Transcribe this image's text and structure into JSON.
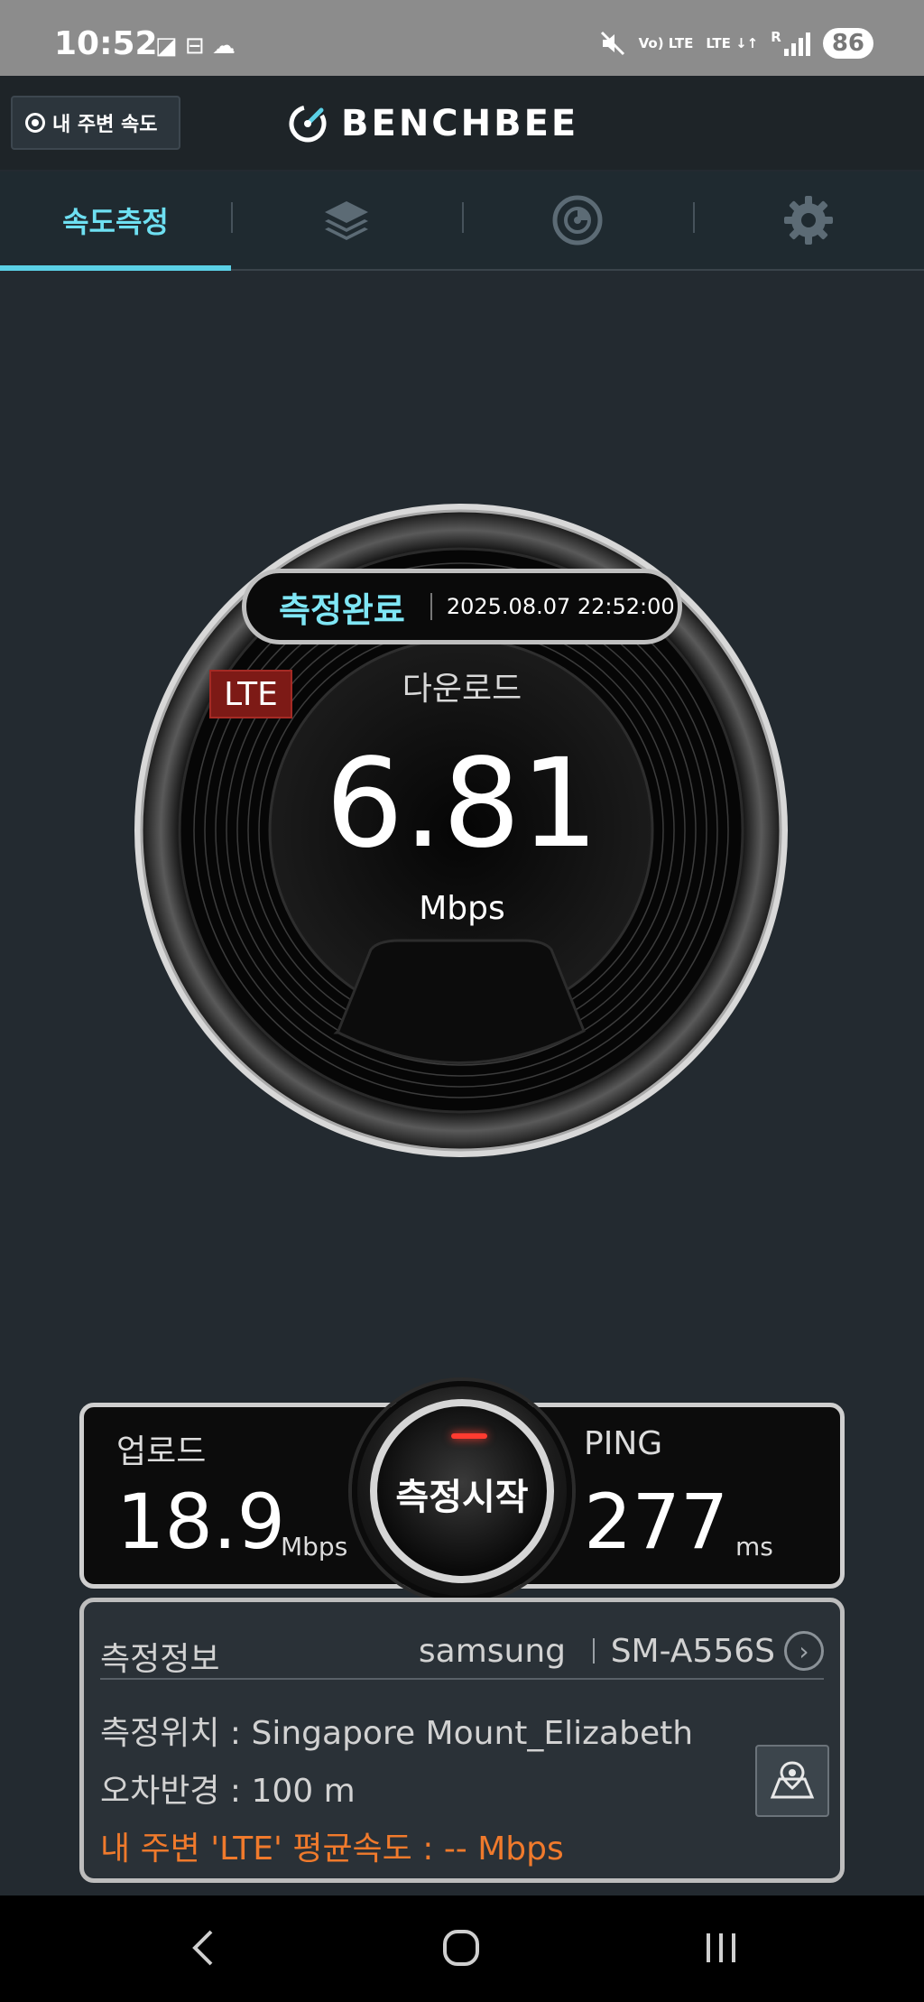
{
  "status_bar": {
    "time": "10:52",
    "notifications": "◪ ⊟ ☁",
    "net_label": "Vo) LTE",
    "net_label2": "LTE ↓↑",
    "signal_label": "R",
    "battery": "86"
  },
  "header": {
    "near_button": "내 주변 속도",
    "logo": "BENCHBEE"
  },
  "tabs": [
    {
      "label": "속도측정",
      "active": true
    },
    {
      "label": "",
      "icon": "layers-icon"
    },
    {
      "label": "",
      "icon": "disc-icon"
    },
    {
      "label": "",
      "icon": "gear-icon"
    }
  ],
  "gauge": {
    "status": "측정완료",
    "datetime": "2025.08.07 22:52:00",
    "network_badge": "LTE",
    "label": "다운로드",
    "value": "6.81",
    "unit": "Mbps"
  },
  "results": {
    "upload": {
      "label": "업로드",
      "value": "18.9",
      "unit": "Mbps"
    },
    "ping": {
      "label": "PING",
      "value": "277",
      "unit": "ms"
    },
    "start_button": "측정시작"
  },
  "info": {
    "title": "측정정보",
    "brand": "samsung",
    "model": "SM-A556S",
    "location": "측정위치 : Singapore  Mount_Elizabeth",
    "error_radius": "오차반경 : 100 m",
    "average": "내 주변 'LTE' 평균속도 :  -- Mbps"
  },
  "colors": {
    "accent": "#5bd0e6",
    "lte_badge": "#7d1a16",
    "orange_text": "#f07a2c",
    "background": "#232a30"
  }
}
